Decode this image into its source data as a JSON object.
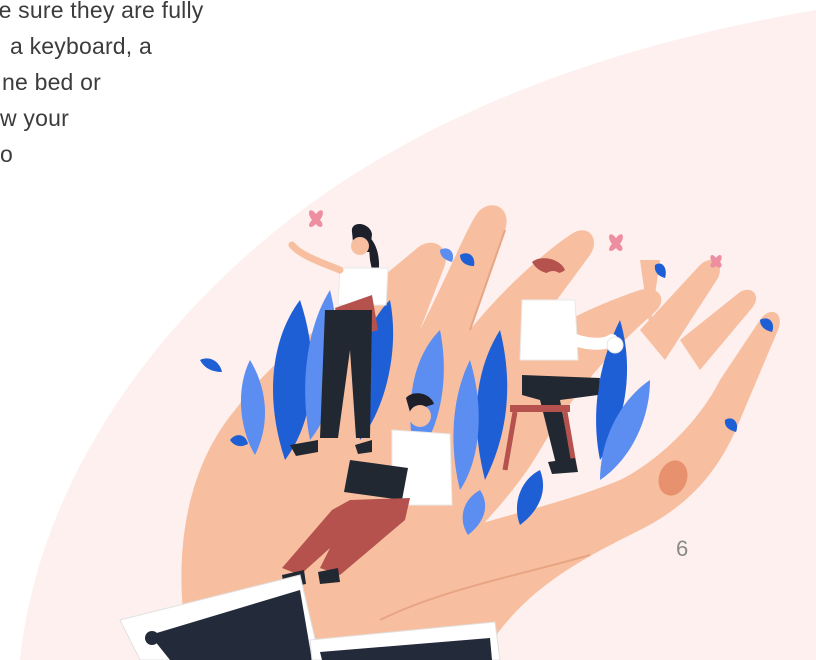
{
  "document": {
    "paragraph_lines": [
      "te sure they are fully",
      "a keyboard, a",
      "ne bed or",
      "w your",
      "o"
    ],
    "page_number": "6"
  },
  "illustration": {
    "subject": "hands-holding-people-illustration",
    "colors": {
      "background_blob": "#fdf0ef",
      "hand_skin": "#f7bfa0",
      "hand_shadow": "#e8a583",
      "leaf_blue": "#1f5fd6",
      "leaf_light_blue": "#5b8ef0",
      "pants_dark": "#222831",
      "pants_red": "#b5524e",
      "shirt_white": "#ffffff",
      "hair_dark": "#1d1f2b",
      "hair_auburn": "#b5524e",
      "butterfly_pink": "#ee8fa1",
      "sleeve_dark": "#232a3a"
    }
  }
}
